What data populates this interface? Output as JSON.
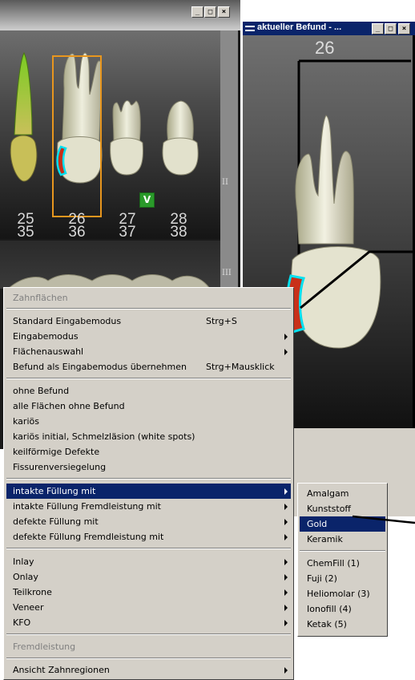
{
  "left_window": {
    "upper_numbers": [
      "25",
      "26",
      "27",
      "28"
    ],
    "lower_numbers": [
      "35",
      "36",
      "37",
      "38"
    ],
    "badge": "V",
    "scroll_marks": [
      "II",
      "III"
    ]
  },
  "right_window": {
    "title": "aktueller Befund - ...",
    "tooth_number": "26"
  },
  "window_buttons": {
    "minimize": "_",
    "maximize": "□",
    "close": "×"
  },
  "context_menu": {
    "header": "Zahnflächen",
    "group1": [
      {
        "label": "Standard Eingabemodus",
        "shortcut": "Strg+S"
      },
      {
        "label": "Eingabemodus",
        "shortcut": ""
      },
      {
        "label": "Flächenauswahl",
        "shortcut": ""
      },
      {
        "label": "Befund als Eingabemodus übernehmen",
        "shortcut": "Strg+Mausklick"
      }
    ],
    "group2": [
      {
        "label": "ohne Befund"
      },
      {
        "label": "alle Flächen ohne Befund"
      },
      {
        "label": "kariös"
      },
      {
        "label": "kariös initial, Schmelzläsion (white spots)"
      },
      {
        "label": "keilförmige Defekte"
      },
      {
        "label": "Fissurenversiegelung"
      }
    ],
    "group3": [
      {
        "label": "intakte Füllung mit"
      },
      {
        "label": "intakte Füllung Fremdleistung mit"
      },
      {
        "label": "defekte Füllung mit"
      },
      {
        "label": "defekte Füllung Fremdleistung mit"
      }
    ],
    "group4": [
      {
        "label": "Inlay"
      },
      {
        "label": "Onlay"
      },
      {
        "label": "Teilkrone"
      },
      {
        "label": "Veneer"
      },
      {
        "label": "KFO"
      }
    ],
    "fremdleistung": "Fremdleistung",
    "ansicht": "Ansicht Zahnregionen"
  },
  "submenu": {
    "materials": [
      "Amalgam",
      "Kunststoff",
      "Gold",
      "Keramik"
    ],
    "products": [
      "ChemFill (1)",
      "Fuji (2)",
      "Heliomolar (3)",
      "Ionofill (4)",
      "Ketak (5)"
    ]
  },
  "colors": {
    "menu_bg": "#d4d0c8",
    "selection": "#0a246a",
    "titlebar": "#0a246a",
    "highlight_frame": "#e8961e",
    "cavity_outline": "#00e0f0",
    "filling_red": "#c8301a",
    "badge_green": "#2a9a2a"
  }
}
